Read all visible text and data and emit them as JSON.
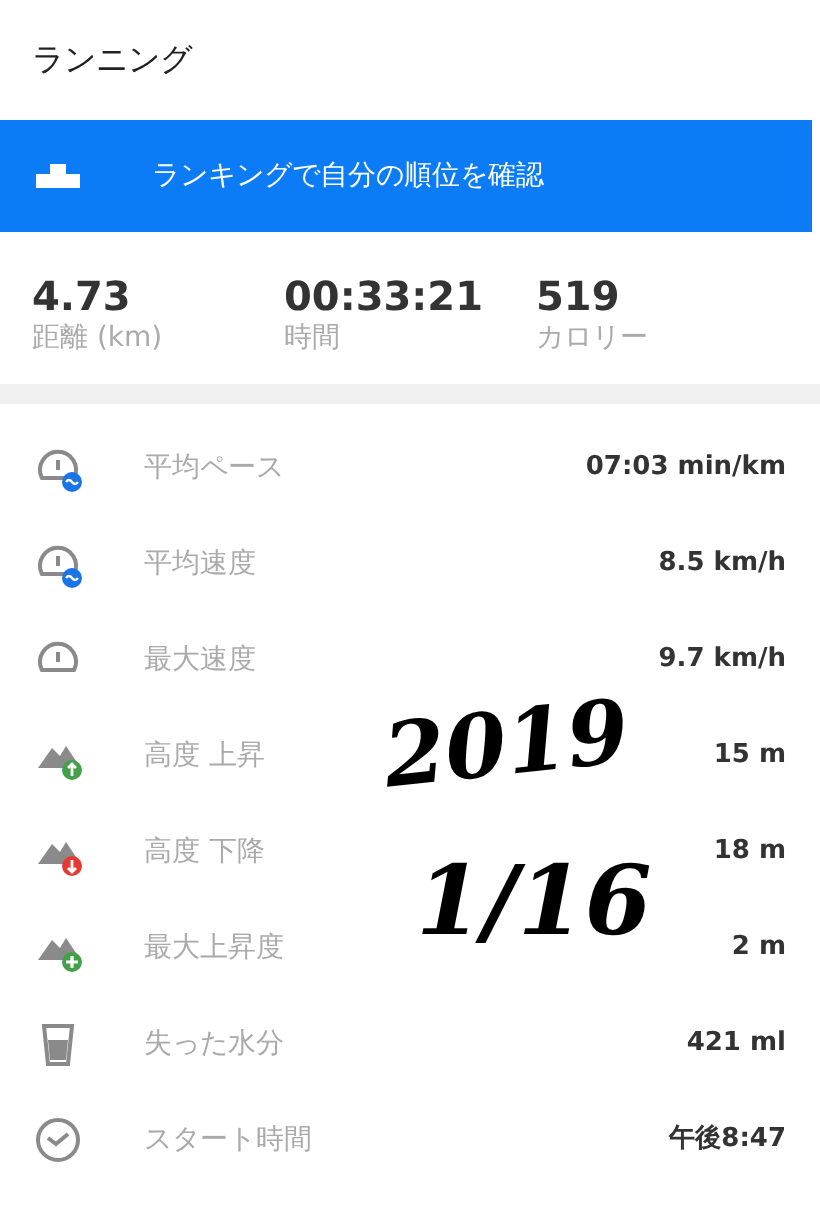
{
  "header": {
    "title": "ランニング"
  },
  "banner": {
    "text": "ランキングで自分の順位を確認"
  },
  "summary": [
    {
      "value": "4.73",
      "label": "距離 (km)"
    },
    {
      "value": "00:33:21",
      "label": "時間"
    },
    {
      "value": "519",
      "label": "カロリー"
    }
  ],
  "details": [
    {
      "kind": "pace",
      "label": "平均ペース",
      "value": "07:03 min/km"
    },
    {
      "kind": "speed",
      "label": "平均速度",
      "value": "8.5 km/h"
    },
    {
      "kind": "max_speed",
      "label": "最大速度",
      "value": "9.7 km/h"
    },
    {
      "kind": "ascent",
      "label": "高度 上昇",
      "value": "15 m"
    },
    {
      "kind": "descent",
      "label": "高度 下降",
      "value": "18 m"
    },
    {
      "kind": "max_ascent",
      "label": "最大上昇度",
      "value": "2 m"
    },
    {
      "kind": "water",
      "label": "失った水分",
      "value": "421 ml"
    },
    {
      "kind": "clock",
      "label": "スタート時間",
      "value": "午後8:47"
    }
  ],
  "handwriting": [
    "2019",
    "1/16"
  ]
}
